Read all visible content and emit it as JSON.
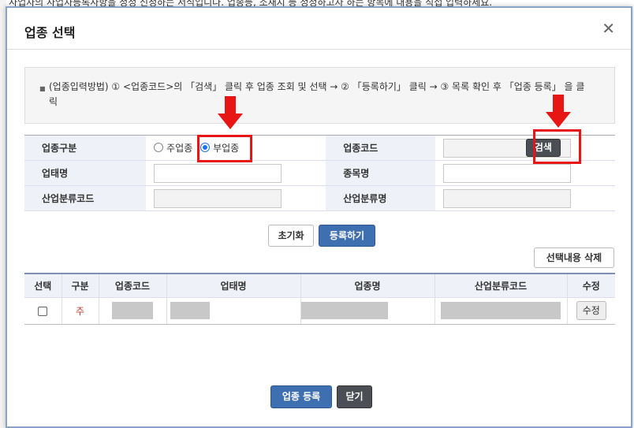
{
  "background": {
    "top_text": "ㆍ사업자의 사업자등록사항을 정정 신청하는 서식입니다. 업종등, 소재지 등 정정하고자 하는 항목에 내용을 직접 입력하세요."
  },
  "modal": {
    "title": "업종 선택",
    "close_symbol": "✕"
  },
  "notice": {
    "text": "(업종입력방법) ① <업종코드>의 「검색」 클릭 후 업종 조회 및 선택 → ② 「등록하기」 클릭 → ③ 목록 확인 후 「업종 등록」 을 클릭"
  },
  "form": {
    "business_type_label": "업종구분",
    "primary_label": "주업종",
    "secondary_label": "부업종",
    "selected": "secondary",
    "industry_code_label": "업종코드",
    "search_label": "검색",
    "business_name_label": "업태명",
    "item_name_label": "종목명",
    "industry_class_code_label": "산업분류코드",
    "industry_class_name_label": "산업분류명"
  },
  "actions": {
    "reset_label": "초기화",
    "register_label": "등록하기",
    "delete_selected_label": "선택내용 삭제"
  },
  "list": {
    "headers": [
      "선택",
      "구분",
      "업종코드",
      "업태명",
      "업종명",
      "산업분류코드",
      "수정"
    ],
    "rows": [
      {
        "type": "주",
        "edit_label": "수정"
      }
    ]
  },
  "footer": {
    "submit_label": "업종 등록",
    "close_label": "닫기"
  },
  "colors": {
    "accent_blue": "#3e6fb0",
    "highlight_red": "#e81515",
    "primary_mark_red": "#c0392b"
  }
}
